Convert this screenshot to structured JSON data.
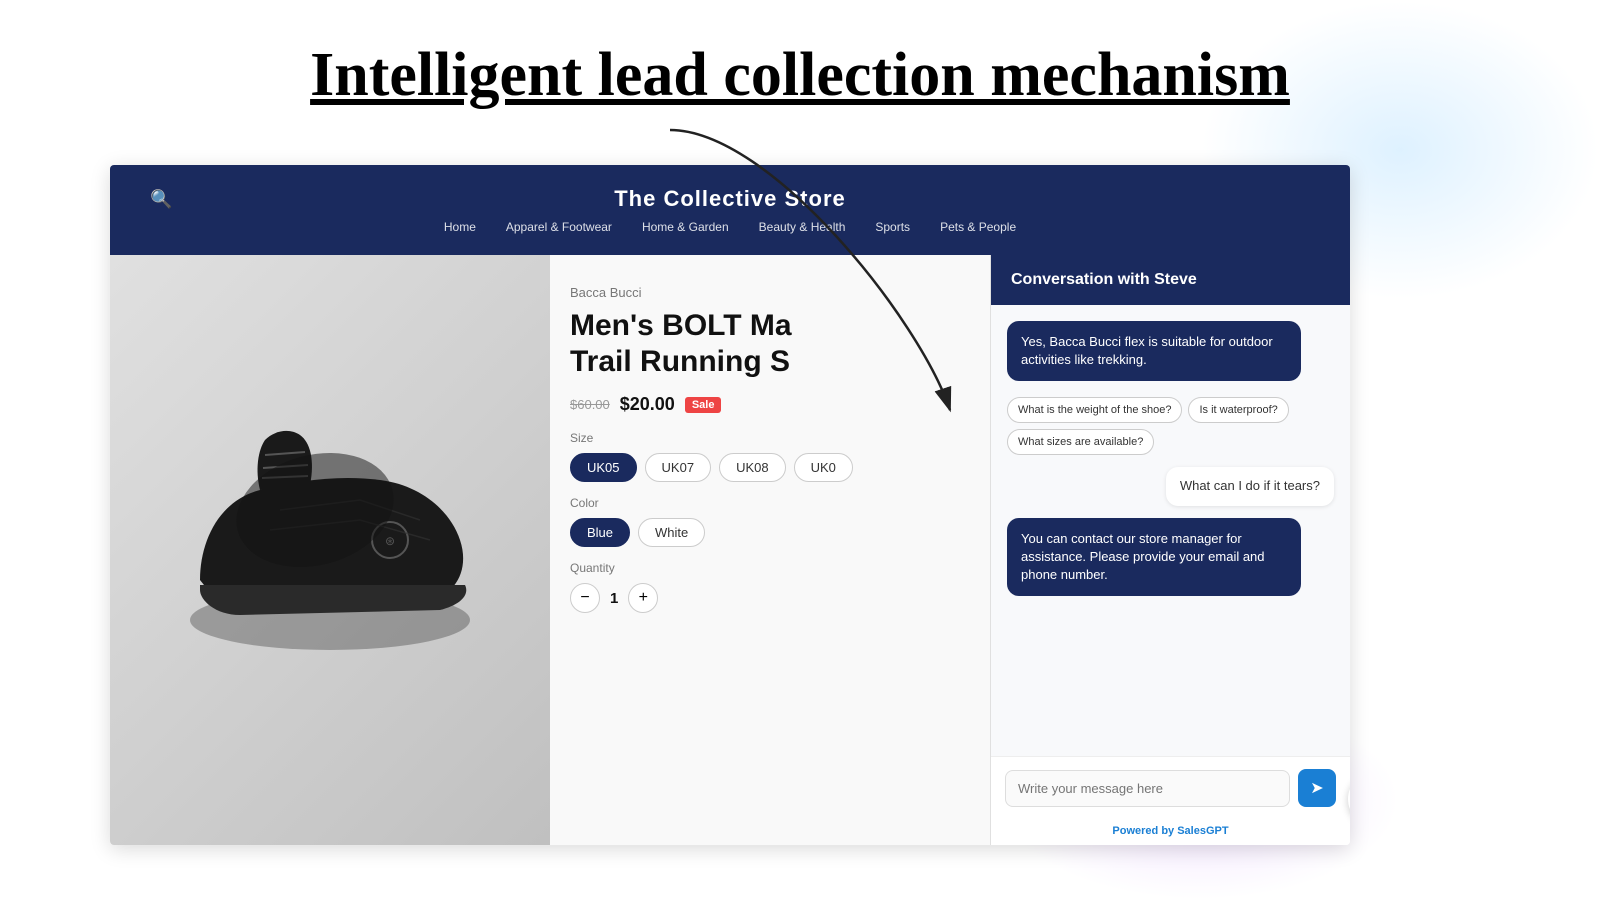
{
  "page": {
    "title": "Intelligent lead collection mechanism"
  },
  "store": {
    "name": "The Collective Store",
    "nav_links": [
      "Home",
      "Apparel & Footwear",
      "Home & Garden",
      "Beauty & Health",
      "Sports",
      "Pets & People"
    ],
    "product": {
      "brand": "Bacca Bucci",
      "name": "Men's BOLT Ma Trail Running S",
      "price_old": "$60.00",
      "price_new": "$20.00",
      "sale_badge": "Sale",
      "size_label": "Size",
      "sizes": [
        "UK05",
        "UK07",
        "UK08",
        "UK0"
      ],
      "color_label": "Color",
      "colors": [
        "Blue",
        "White"
      ],
      "qty_label": "Quantity",
      "qty_value": "1"
    }
  },
  "chat": {
    "header": "Conversation with Steve",
    "messages": [
      {
        "type": "bot",
        "text": "Yes, Bacca Bucci flex is suitable for outdoor activities like trekking."
      },
      {
        "type": "quick_replies",
        "replies": [
          "What is the weight of the shoe?",
          "Is it waterproof?",
          "What sizes are available?"
        ]
      },
      {
        "type": "user",
        "text": "What can I do if it tears?"
      },
      {
        "type": "bot",
        "text": "You can contact our store manager for assistance. Please provide your email and phone number."
      }
    ],
    "input_placeholder": "Write your message here",
    "powered_by_label": "Powered by ",
    "powered_by_brand": "SalesGPT",
    "send_btn_label": "Send"
  }
}
